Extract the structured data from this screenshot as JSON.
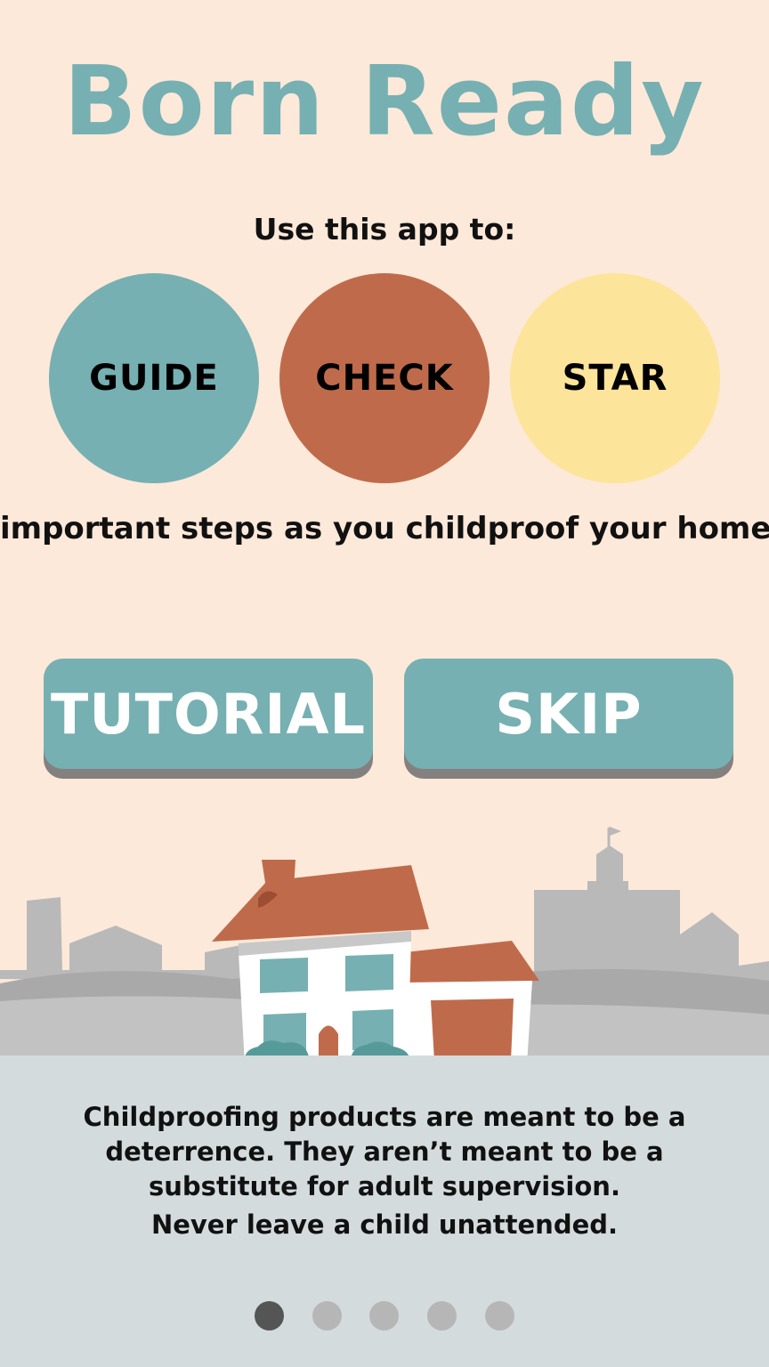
{
  "header": {
    "title": "Born Ready"
  },
  "intro": {
    "lead": "Use this app to:",
    "circles": [
      "GUIDE",
      "CHECK",
      "STAR"
    ],
    "tail": "important steps as you childproof your home."
  },
  "buttons": {
    "tutorial": "TUTORIAL",
    "skip": "SKIP"
  },
  "disclaimer": {
    "line1": "Childproofing products are meant to be a",
    "line2": "deterrence. They aren’t meant to be a",
    "line3": "substitute for adult supervision.",
    "line4": "Never leave a child unattended."
  },
  "pager": {
    "page": 1,
    "total": 5
  },
  "colors": {
    "background": "#fde9d9",
    "teal": "#76b0b2",
    "terracotta": "#bf6b4b",
    "yellow": "#fde49b",
    "panel": "#d3dbdd"
  },
  "illustration": {
    "name": "house-illustration"
  }
}
